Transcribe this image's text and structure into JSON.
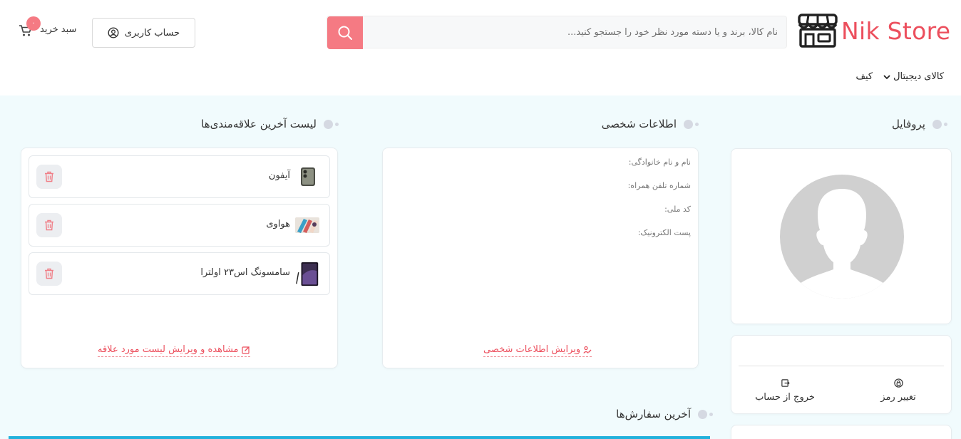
{
  "brand": {
    "name": "Nik Store",
    "color": "#ec4f5d"
  },
  "search": {
    "placeholder": "نام کالا، برند و یا دسته مورد نظر خود را جستجو کنید...",
    "button_icon": "search-icon"
  },
  "account": {
    "label": "حساب کاربری",
    "icon": "user-circle-icon"
  },
  "cart": {
    "label": "سبد خرید",
    "count": "۰",
    "icon": "cart-icon"
  },
  "nav": [
    {
      "label": "کالای دیجیتال",
      "has_dropdown": true
    },
    {
      "label": "کیف",
      "has_dropdown": false
    }
  ],
  "profile": {
    "title": "پروفایل",
    "avatar": "default-avatar"
  },
  "actions": {
    "change_password": "تغییر رمز",
    "logout": "خروج از حساب"
  },
  "personal_info": {
    "title": "اطلاعات شخصی",
    "fields": [
      "نام و نام خانوادگی:",
      "شماره تلفن همراه:",
      "کد ملی:",
      "پست الکترونیک:"
    ],
    "edit_link": "ویرایش اطلاعات شخصی"
  },
  "favorites": {
    "title": "لیست آخرین علاقه‌مندی‌ها",
    "items": [
      {
        "name": "آیفون"
      },
      {
        "name": "هواوی"
      },
      {
        "name": "سامسونگ اس۲۳ اولترا"
      }
    ],
    "edit_link": "مشاهده و ویرایش لیست مورد علاقه"
  },
  "orders": {
    "title": "آخرین سفارش‌ها"
  },
  "colors": {
    "accent": "#ec4f5d",
    "page_bg": "#f1fbfd",
    "orders_bar": "#22b2dc"
  }
}
